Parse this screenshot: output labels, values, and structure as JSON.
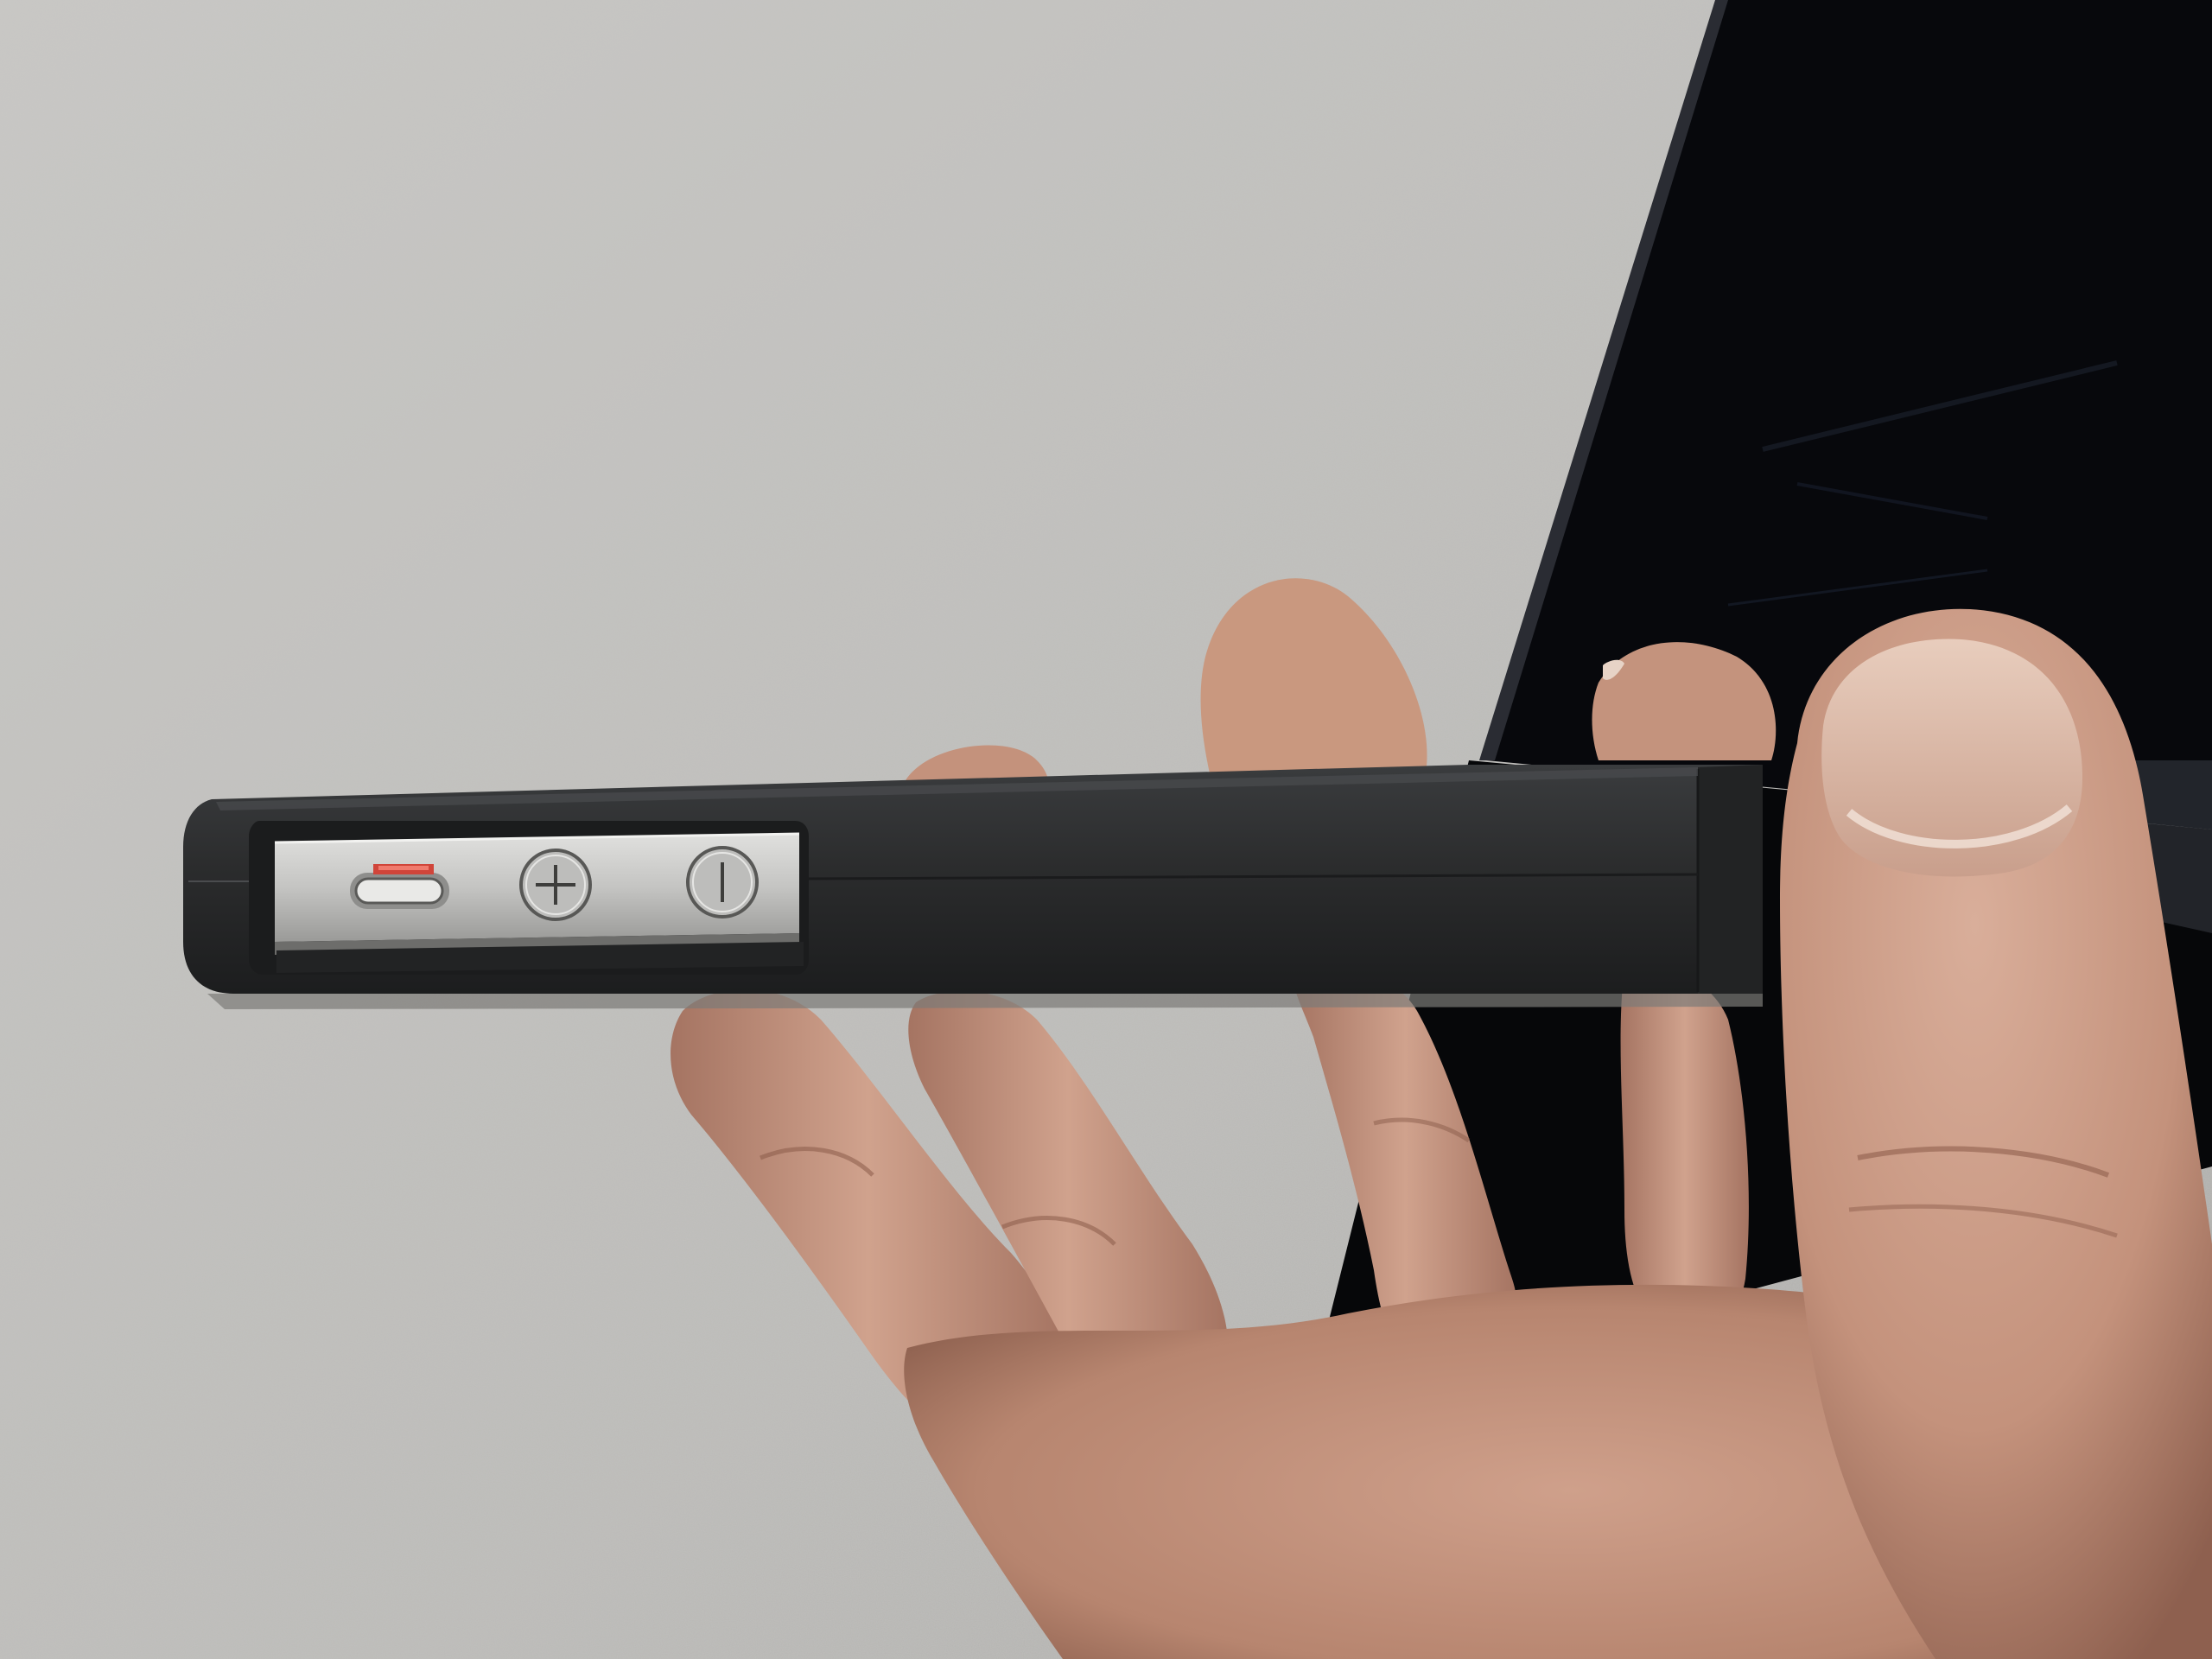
{
  "scene": {
    "subject": "photo",
    "colors": {
      "table_surface": "#bdbcb9",
      "table_speckle_light": "#d4d3d0",
      "table_speckle_dark": "#8f8e8b",
      "laptop_body": "#07080c",
      "laptop_edge": "#2a2c33",
      "case_body": "#2a2b2c",
      "case_highlight": "#3d3f41",
      "metal_band": "#c9c9c7",
      "metal_band_shadow": "#8e8e8c",
      "skin": "#c89b86",
      "skin_shadow": "#9a6c5a",
      "skin_highlight": "#e2bcaa",
      "mute_switch_accent": "#d0453a"
    },
    "icons": [
      "mute-switch-icon",
      "volume-up-icon",
      "volume-down-icon"
    ]
  }
}
